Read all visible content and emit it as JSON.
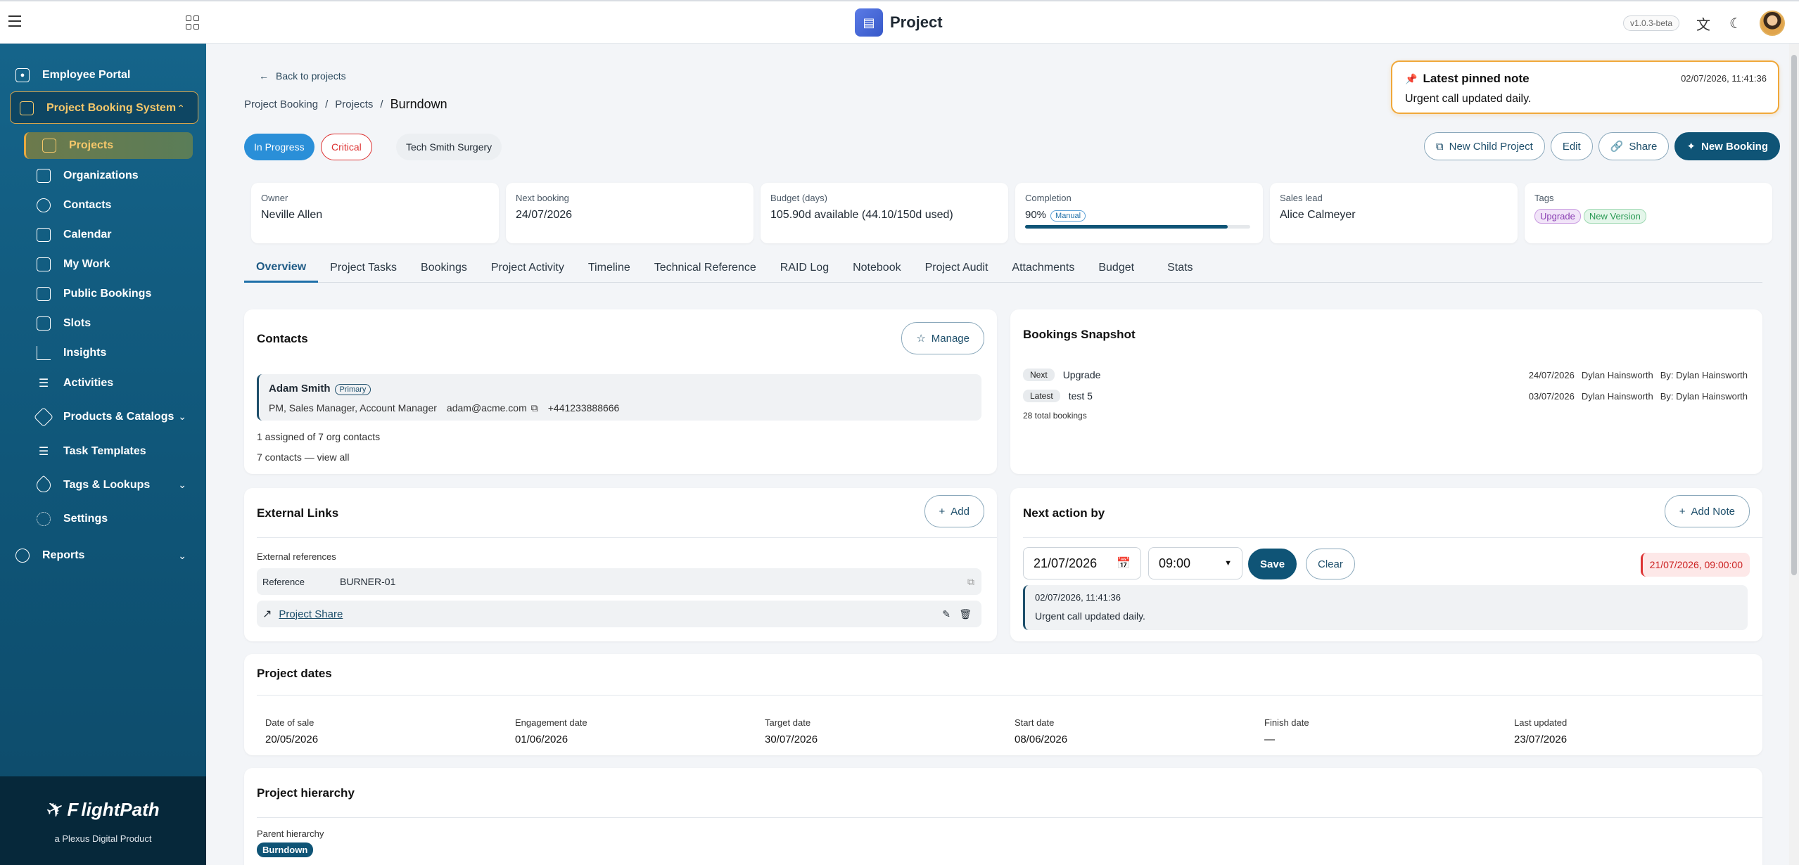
{
  "topbar": {
    "title": "Project",
    "version": "v1.0.3-beta"
  },
  "sidebar": {
    "items": [
      {
        "label": "Employee Portal"
      },
      {
        "label": "Project Booking System"
      },
      {
        "label": "Projects"
      },
      {
        "label": "Organizations"
      },
      {
        "label": "Contacts"
      },
      {
        "label": "Calendar"
      },
      {
        "label": "My Work"
      },
      {
        "label": "Public Bookings"
      },
      {
        "label": "Slots"
      },
      {
        "label": "Insights"
      },
      {
        "label": "Activities"
      },
      {
        "label": "Products & Catalogs"
      },
      {
        "label": "Task Templates"
      },
      {
        "label": "Tags & Lookups"
      },
      {
        "label": "Settings"
      },
      {
        "label": "Reports"
      }
    ],
    "footer_brand": "lightPath",
    "footer_brand_initial": "F",
    "footer_sub": "a Plexus Digital Product"
  },
  "page": {
    "back_label": "Back to projects",
    "breadcrumb": [
      "Project Booking",
      "Projects",
      "Burndown"
    ],
    "chips": {
      "status": "In Progress",
      "priority": "Critical",
      "client": "Tech Smith Surgery"
    },
    "pinned": {
      "title": "Latest pinned note",
      "date": "02/07/2026, 11:41:36",
      "body": "Urgent call updated daily."
    },
    "actions": {
      "child": "New Child Project",
      "edit": "Edit",
      "share": "Share",
      "booking": "New Booking"
    }
  },
  "summary": {
    "owner": {
      "label": "Owner",
      "value": "Neville Allen"
    },
    "next_booking": {
      "label": "Next booking",
      "value": "24/07/2026"
    },
    "budget": {
      "label": "Budget (days)",
      "value": "105.90d available (44.10/150d used)"
    },
    "completion": {
      "label": "Completion",
      "value": "90%",
      "badge": "Manual",
      "progress": 0.9
    },
    "sales_lead": {
      "label": "Sales lead",
      "value": "Alice Calmeyer"
    },
    "tags": {
      "label": "Tags",
      "items": [
        "Upgrade",
        "New Version"
      ]
    }
  },
  "tabs": [
    "Overview",
    "Project Tasks",
    "Bookings",
    "Project Activity",
    "Timeline",
    "Technical Reference",
    "RAID Log",
    "Notebook",
    "Project Audit",
    "Attachments",
    "Budget",
    "Stats"
  ],
  "contacts": {
    "title": "Contacts",
    "manage": "Manage",
    "primary": {
      "name": "Adam Smith",
      "badge": "Primary",
      "roles": "PM, Sales Manager, Account Manager",
      "email": "adam@acme.com",
      "phone": "+441233888666"
    },
    "assigned": "1 assigned of 7 org contacts",
    "view_all": "7 contacts — view all"
  },
  "bookings": {
    "title": "Bookings Snapshot",
    "rows": [
      {
        "pill": "Next",
        "name": "Upgrade",
        "date": "24/07/2026",
        "person": "Dylan Hainsworth",
        "by": "By: Dylan Hainsworth"
      },
      {
        "pill": "Latest",
        "name": "test 5",
        "date": "03/07/2026",
        "person": "Dylan Hainsworth",
        "by": "By: Dylan Hainsworth"
      }
    ],
    "total": "28 total bookings"
  },
  "links": {
    "title": "External Links",
    "add": "Add",
    "refs_label": "External references",
    "ref_key": "Reference",
    "ref_value": "BURNER-01",
    "share_link": "Project Share"
  },
  "next_action": {
    "title": "Next action by",
    "add_note": "Add Note",
    "date": "21/07/2026",
    "time": "09:00",
    "save": "Save",
    "clear": "Clear",
    "overdue": "21/07/2026, 09:00:00",
    "note_date": "02/07/2026, 11:41:36",
    "note_body": "Urgent call updated daily."
  },
  "dates": {
    "title": "Project dates",
    "cols": [
      {
        "label": "Date of sale",
        "value": "20/05/2026"
      },
      {
        "label": "Engagement date",
        "value": "01/06/2026"
      },
      {
        "label": "Target date",
        "value": "30/07/2026"
      },
      {
        "label": "Start date",
        "value": "08/06/2026"
      },
      {
        "label": "Finish date",
        "value": "—"
      },
      {
        "label": "Last updated",
        "value": "23/07/2026"
      }
    ]
  },
  "hierarchy": {
    "title": "Project hierarchy",
    "label": "Parent hierarchy",
    "chip": "Burndown"
  },
  "colors": {
    "sidebar": "#0f5476",
    "accent": "#e6a940",
    "primary": "#0f5476"
  }
}
